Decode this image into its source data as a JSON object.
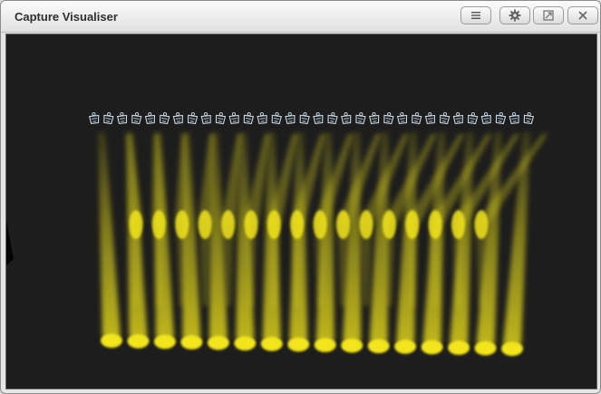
{
  "window": {
    "title": "Capture Visualiser",
    "controls": [
      "menu-icon",
      "gear-icon",
      "restore-icon",
      "close-icon"
    ]
  },
  "scene": {
    "background_color": "#1d1d1d",
    "beam_color": "#d8cf1a",
    "spot_color": "#f2e51c",
    "fixture_outline_color": "#c9dbe8",
    "fixture_count": 32,
    "floor_spot_count": 16,
    "mid_spot_count": 16
  }
}
